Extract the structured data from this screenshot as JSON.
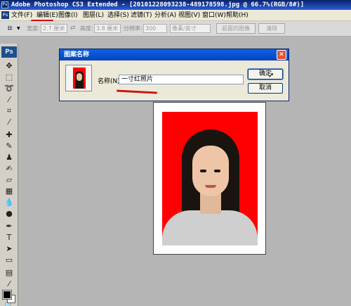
{
  "window": {
    "title": "Adobe Photoshop CS3 Extended - [20101228093238-489178598.jpg @ 66.7%(RGB/8#)]"
  },
  "menu": {
    "items": [
      "文件(F)",
      "编辑(E)",
      "图像(I)",
      "图层(L)",
      "选择(S)",
      "滤镜(T)",
      "分析(A)",
      "视图(V)",
      "窗口(W)",
      "帮助(H)"
    ]
  },
  "options": {
    "width_label": "宽度:",
    "width_value": "2.7 厘米",
    "height_label": "高度:",
    "height_value": "3.8 厘米",
    "resolution_label": "分辨率:",
    "resolution_value": "300",
    "unit_value": "像素/英寸",
    "front_image_button": "前面的图像",
    "clear_button": "清除"
  },
  "tools": {
    "logo": "Ps"
  },
  "dialog": {
    "title": "图案名称",
    "name_label": "名称(N):",
    "name_value": "一寸红照片",
    "ok_button": "确定",
    "cancel_button": "取消"
  },
  "colors": {
    "photo_background": "#ff0000",
    "annotation": "#d01010",
    "dialog_title_bar": "#0a62e8"
  }
}
